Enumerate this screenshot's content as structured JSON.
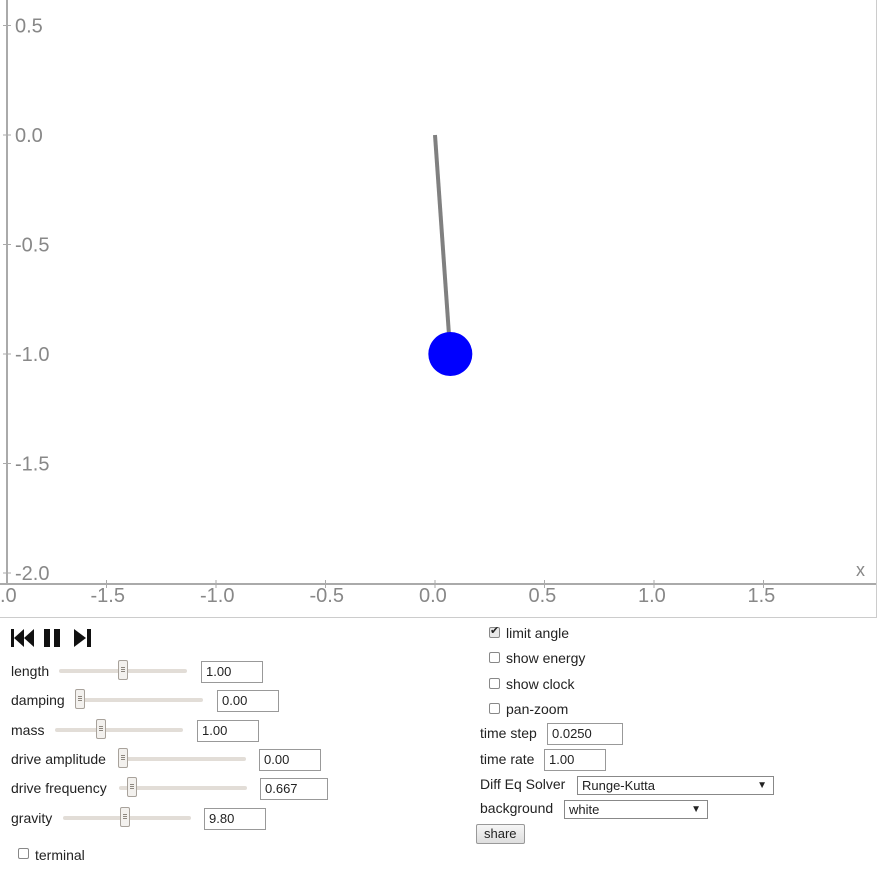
{
  "graph": {
    "y_ticks": [
      "0.5",
      "0.0",
      "-0.5",
      "-1.0",
      "-1.5",
      "-2.0"
    ],
    "x_ticks": [
      ".0",
      "-1.5",
      "-1.0",
      "-0.5",
      "0.0",
      "0.5",
      "1.0",
      "1.5"
    ],
    "x_axis_name": "x",
    "pendulum": {
      "pivot": [
        0.0,
        0.0
      ],
      "bob": [
        0.07,
        -1.0
      ],
      "bob_color": "#0000ff",
      "rod_color": "#808080"
    }
  },
  "playback": {
    "rewind_icon": "rewind-icon",
    "pause_icon": "pause-icon",
    "step_icon": "step-forward-icon"
  },
  "params": {
    "length": {
      "label": "length",
      "value": "1.00"
    },
    "damping": {
      "label": "damping",
      "value": "0.00"
    },
    "mass": {
      "label": "mass",
      "value": "1.00"
    },
    "drive_amplitude": {
      "label": "drive amplitude",
      "value": "0.00"
    },
    "drive_frequency": {
      "label": "drive frequency",
      "value": "0.667"
    },
    "gravity": {
      "label": "gravity",
      "value": "9.80"
    }
  },
  "terminal_label": "terminal",
  "options": {
    "limit_angle": "limit angle",
    "show_energy": "show energy",
    "show_clock": "show clock",
    "pan_zoom": "pan-zoom"
  },
  "time_step": {
    "label": "time step",
    "value": "0.0250"
  },
  "time_rate": {
    "label": "time rate",
    "value": "1.00"
  },
  "solver": {
    "label": "Diff Eq Solver",
    "value": "Runge-Kutta"
  },
  "background": {
    "label": "background",
    "value": "white"
  },
  "share_label": "share"
}
